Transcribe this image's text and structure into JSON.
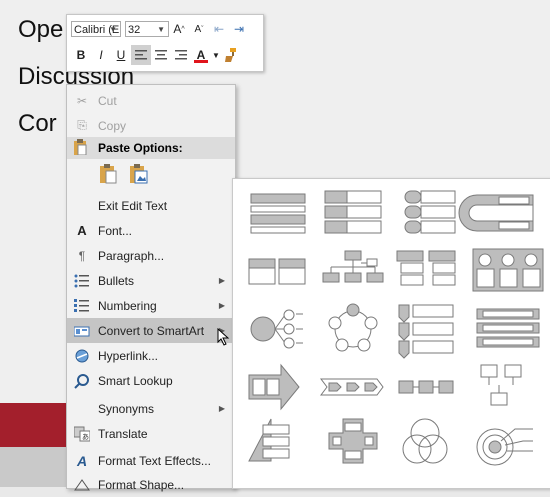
{
  "slide": {
    "lines": [
      "Ope",
      "Discussion",
      "Cor"
    ]
  },
  "mini_toolbar": {
    "font_name": "Calibri (E",
    "font_size": "32",
    "grow_font": "A",
    "shrink_font": "A",
    "bold": "B",
    "italic": "I",
    "underline": "U",
    "font_color": "A"
  },
  "context_menu": {
    "cut": "Cut",
    "copy": "Copy",
    "paste_options": "Paste Options:",
    "exit_edit_text": "Exit Edit Text",
    "font": "Font...",
    "paragraph": "Paragraph...",
    "bullets": "Bullets",
    "numbering": "Numbering",
    "convert_smartart": "Convert to SmartArt",
    "hyperlink": "Hyperlink...",
    "smart_lookup": "Smart Lookup",
    "synonyms": "Synonyms",
    "translate": "Translate",
    "format_text_effects": "Format Text Effects...",
    "format_shape": "Format Shape..."
  },
  "colors": {
    "accent_red": "#a31f2c",
    "highlight": "#c5c5c5",
    "font_color_bar": "#e0141c"
  },
  "smartart_gallery": {
    "layouts": [
      "vertical-bullet-list-icon",
      "vertical-box-list-icon",
      "vertical-bracket-list-icon",
      "trapezoid-list-icon",
      "horizontal-bullet-list-icon",
      "organization-chart-icon",
      "table-list-icon",
      "picture-caption-list-icon",
      "radial-list-icon",
      "basic-cycle-icon",
      "vertical-arrow-list-icon",
      "stacked-list-icon",
      "converging-arrows-icon",
      "chevron-process-icon",
      "basic-process-icon",
      "picture-accent-list-icon",
      "pyramid-list-icon",
      "cross-arrows-icon",
      "venn-icon",
      "target-icon"
    ]
  }
}
